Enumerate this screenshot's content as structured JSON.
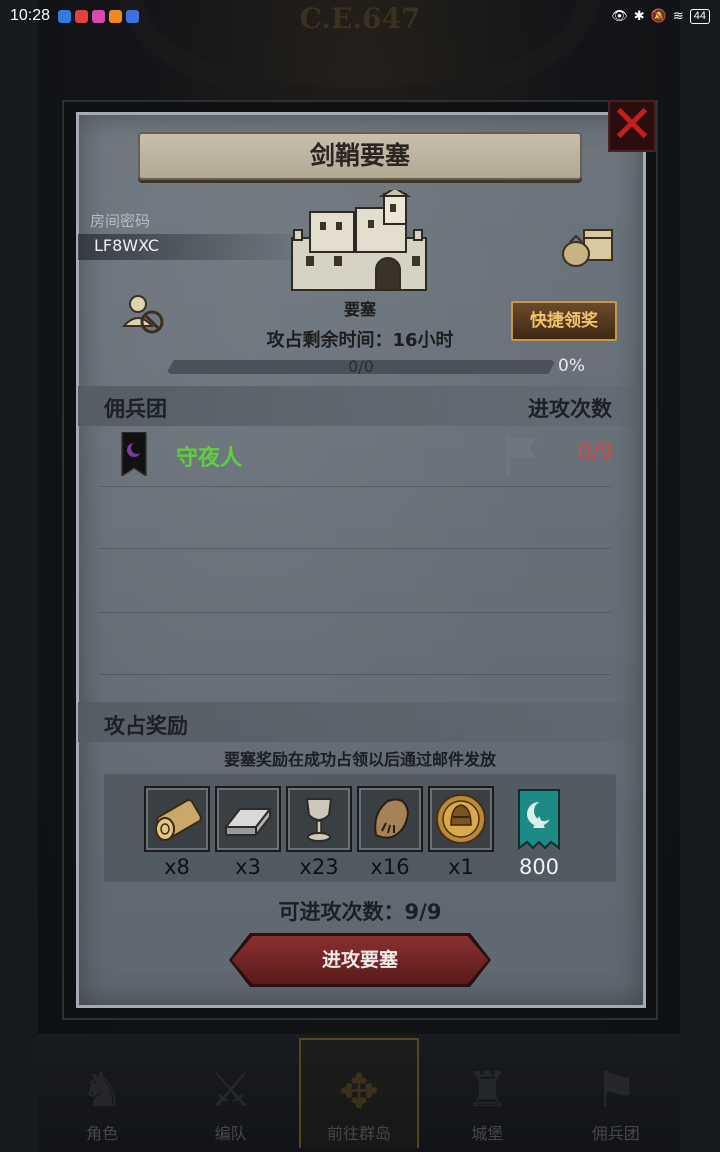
{
  "status_bar": {
    "time": "10:28",
    "battery": "44"
  },
  "background": {
    "era": "C.E.647"
  },
  "dialog": {
    "title": "剑鞘要塞",
    "room_code_label": "房间密码",
    "room_code": "LF8WXC",
    "castle_label": "要塞",
    "quick_claim": "快捷领奖",
    "remaining_time": "攻占剩余时间：16小时",
    "progress": {
      "text": "0/0",
      "percent_text": "0%",
      "fraction": 0
    },
    "mercs_header": {
      "left": "佣兵团",
      "right": "进攻次数"
    },
    "mercenaries": [
      {
        "name": "守夜人",
        "attacks": "0/9"
      }
    ],
    "rewards_header": "攻占奖励",
    "reward_note": "要塞奖励在成功占领以后通过邮件发放",
    "rewards": [
      {
        "icon": "wood-log-icon",
        "count": "x8"
      },
      {
        "icon": "iron-ingot-icon",
        "count": "x3"
      },
      {
        "icon": "goblet-icon",
        "count": "x23"
      },
      {
        "icon": "fur-pelt-icon",
        "count": "x16"
      },
      {
        "icon": "knight-helmet-coin-icon",
        "count": "x1"
      },
      {
        "icon": "guild-banner-icon",
        "count": "800"
      }
    ],
    "attacks_available": "可进攻次数：9/9",
    "attack_button": "进攻要塞"
  },
  "bottom_nav": [
    {
      "label": "角色",
      "icon": "character-icon"
    },
    {
      "label": "编队",
      "icon": "formation-icon"
    },
    {
      "label": "前往群岛",
      "icon": "compass-icon"
    },
    {
      "label": "城堡",
      "icon": "castle-icon"
    },
    {
      "label": "佣兵团",
      "icon": "mercenary-icon"
    }
  ]
}
